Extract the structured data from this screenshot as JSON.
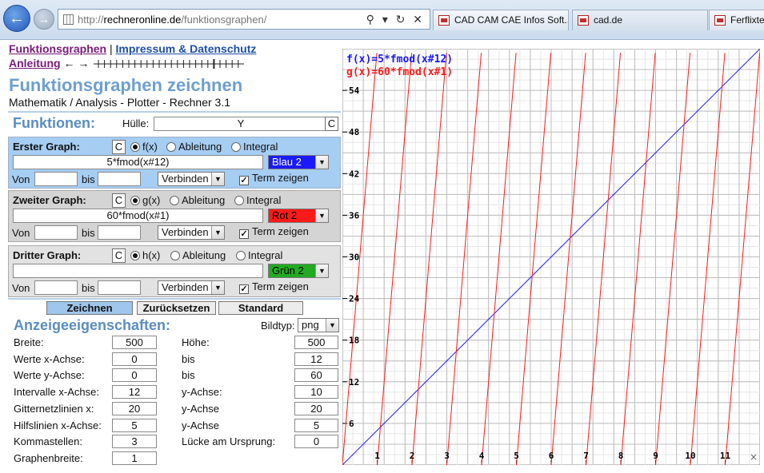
{
  "browser": {
    "url_prefix": "http://",
    "url_domain": "rechneronline.de",
    "url_path": "/funktionsgraphen/",
    "url_tools": "⚲ ▾ ↻ ✕",
    "tabs": [
      {
        "label": "CAD CAM CAE Infos Soft..."
      },
      {
        "label": "cad.de"
      },
      {
        "label": "Ferflixte"
      }
    ]
  },
  "nav": {
    "link1": "Funktionsgraphen",
    "sep": "|",
    "link2": "Impressum & Datenschutz",
    "link3": "Anleitung",
    "arrows": "← →"
  },
  "header": {
    "title": "Funktionsgraphen zeichnen",
    "subtitle": "Mathematik / Analysis - Plotter - Rechner 3.1"
  },
  "functions": {
    "section_label": "Funktionen:",
    "huelle_label": "Hülle:",
    "huelle_value": "Y",
    "clear_label": "C",
    "graphs": [
      {
        "label": "Erster Graph:",
        "clear": "C",
        "opt1": "f(x)",
        "opt2": "Ableitung",
        "opt3": "Integral",
        "term": "5*fmod(x#12)",
        "color": "Blau 2",
        "color_hex": "#1a1aff",
        "color_text": "#ffffff",
        "von_label": "Von",
        "von": "",
        "bis_label": "bis",
        "bis": "",
        "mode": "Verbinden",
        "term_show": "Term zeigen",
        "check": "✓"
      },
      {
        "label": "Zweiter Graph:",
        "clear": "C",
        "opt1": "g(x)",
        "opt2": "Ableitung",
        "opt3": "Integral",
        "term": "60*fmod(x#1)",
        "color": "Rot 2",
        "color_hex": "#ff1a1a",
        "color_text": "#000000",
        "von_label": "Von",
        "von": "",
        "bis_label": "bis",
        "bis": "",
        "mode": "Verbinden",
        "term_show": "Term zeigen",
        "check": "✓"
      },
      {
        "label": "Dritter Graph:",
        "clear": "C",
        "opt1": "h(x)",
        "opt2": "Ableitung",
        "opt3": "Integral",
        "term": "",
        "color": "Grün 2",
        "color_hex": "#22aa22",
        "color_text": "#000000",
        "von_label": "Von",
        "von": "",
        "bis_label": "bis",
        "bis": "",
        "mode": "Verbinden",
        "term_show": "Term zeigen",
        "check": "✓"
      }
    ]
  },
  "actions": {
    "draw": "Zeichnen",
    "reset": "Zurücksetzen",
    "standard": "Standard"
  },
  "display": {
    "section_label": "Anzeigeeigenschaften:",
    "bildtyp_label": "Bildtyp:",
    "bildtyp_value": "png",
    "rows": [
      {
        "l": "Breite:",
        "v": "500",
        "r": "Höhe:",
        "rv": "500"
      },
      {
        "l": "Werte x-Achse:",
        "v": "0",
        "r": "bis",
        "rv": "12"
      },
      {
        "l": "Werte y-Achse:",
        "v": "0",
        "r": "bis",
        "rv": "60"
      },
      {
        "l": "Intervalle x-Achse:",
        "v": "12",
        "r": "y-Achse:",
        "rv": "10"
      },
      {
        "l": "Gitternetzlinien x:",
        "v": "20",
        "r": "y-Achse",
        "rv": "20"
      },
      {
        "l": "Hilfslinien x-Achse:",
        "v": "5",
        "r": "y-Achse",
        "rv": "5"
      },
      {
        "l": "Kommastellen:",
        "v": "3",
        "r": "Lücke am Ursprung:",
        "rv": "0"
      },
      {
        "l": "Graphenbreite:",
        "v": "1",
        "r": "",
        "rv": ""
      }
    ]
  },
  "chart_data": {
    "type": "line",
    "title": "",
    "xlim": [
      0,
      12
    ],
    "ylim": [
      0,
      60
    ],
    "x_ticks": [
      "1",
      "2",
      "3",
      "4",
      "5",
      "6",
      "7",
      "8",
      "9",
      "10",
      "11"
    ],
    "y_ticks": [
      "6",
      "12",
      "18",
      "24",
      "30",
      "36",
      "42",
      "48",
      "54"
    ],
    "x_interval": 12,
    "y_interval": 10,
    "grid_x": 20,
    "grid_y": 20,
    "grid": true,
    "corner_mark": "×",
    "series": [
      {
        "name": "f(x)=5*fmod(x#12)",
        "color": "#1a1aff",
        "expr": "5*fmod(x,12)"
      },
      {
        "name": "g(x)=60*fmod(x#1)",
        "color": "#ff1a1a",
        "expr": "60*fmod(x,1)"
      }
    ]
  }
}
